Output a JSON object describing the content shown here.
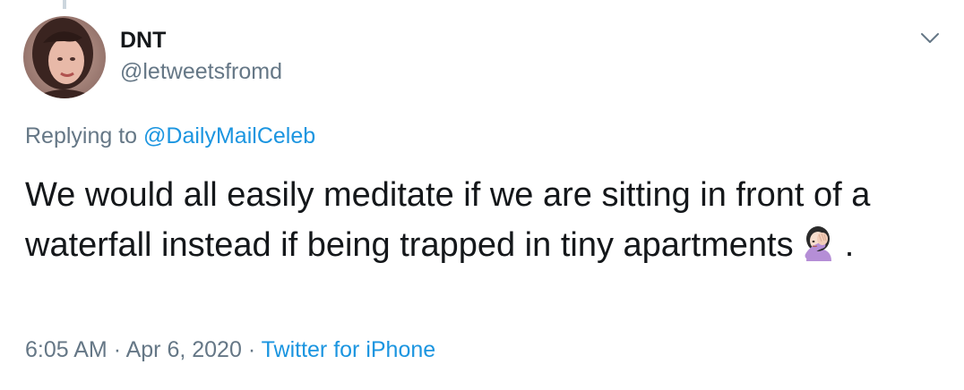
{
  "tweet": {
    "author": {
      "display_name": "DNT",
      "handle": "@letweetsfromd"
    },
    "reply": {
      "prefix": "Replying to",
      "mention": "@DailyMailCeleb"
    },
    "text": "We would all easily meditate if we are sitting in front of a waterfall instead if being trapped in tiny apartments",
    "emoji": "woman-facepalming-icon",
    "text_end": ".",
    "time": "6:05 AM",
    "separator": "·",
    "date": "Apr 6, 2020",
    "source": "Twitter for iPhone"
  },
  "colors": {
    "link": "#1b95e0",
    "muted": "#657786",
    "text": "#14171a"
  },
  "icons": {
    "menu": "chevron-down-icon",
    "avatar": "avatar"
  }
}
